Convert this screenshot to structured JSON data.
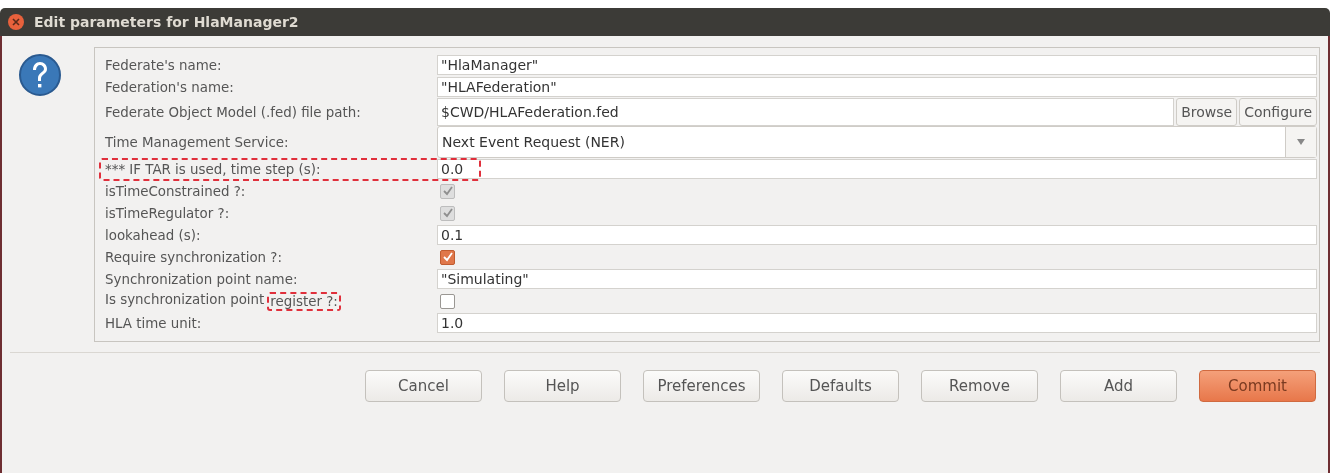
{
  "window": {
    "title": "Edit parameters for HlaManager2"
  },
  "rows": [
    {
      "kind": "text",
      "label": "Federate's name:",
      "value": "\"HlaManager\""
    },
    {
      "kind": "text",
      "label": "Federation's name:",
      "value": "\"HLAFederation\""
    },
    {
      "kind": "file",
      "label": "Federate Object Model (.fed) file path:",
      "value": "$CWD/HLAFederation.fed",
      "buttons": [
        "Browse",
        "Configure"
      ]
    },
    {
      "kind": "select",
      "label": "Time Management Service:",
      "value": "Next Event Request (NER)"
    },
    {
      "kind": "text",
      "label": "*** IF TAR is used, time step (s):",
      "value": "0.0",
      "marked": true
    },
    {
      "kind": "checkbox",
      "label": "isTimeConstrained ?:",
      "checked": true,
      "disabled": true
    },
    {
      "kind": "checkbox",
      "label": "isTimeRegulator ?:",
      "checked": true,
      "disabled": true
    },
    {
      "kind": "text",
      "label": "lookahead (s):",
      "value": "0.1"
    },
    {
      "kind": "checkbox",
      "label": "Require synchronization ?:",
      "checked": true,
      "disabled": false
    },
    {
      "kind": "text",
      "label": "Synchronization point name:",
      "value": "\"Simulating\""
    },
    {
      "kind": "checkbox",
      "label": "Is synchronization point",
      "marked_label": "register ?:",
      "checked": false,
      "disabled": false
    },
    {
      "kind": "text",
      "label": "HLA time unit:",
      "value": "1.0"
    }
  ],
  "buttons": [
    {
      "label": "Cancel",
      "default": false
    },
    {
      "label": "Help",
      "default": false
    },
    {
      "label": "Preferences",
      "default": false
    },
    {
      "label": "Defaults",
      "default": false
    },
    {
      "label": "Remove",
      "default": false
    },
    {
      "label": "Add",
      "default": false
    },
    {
      "label": "Commit",
      "default": true
    }
  ]
}
